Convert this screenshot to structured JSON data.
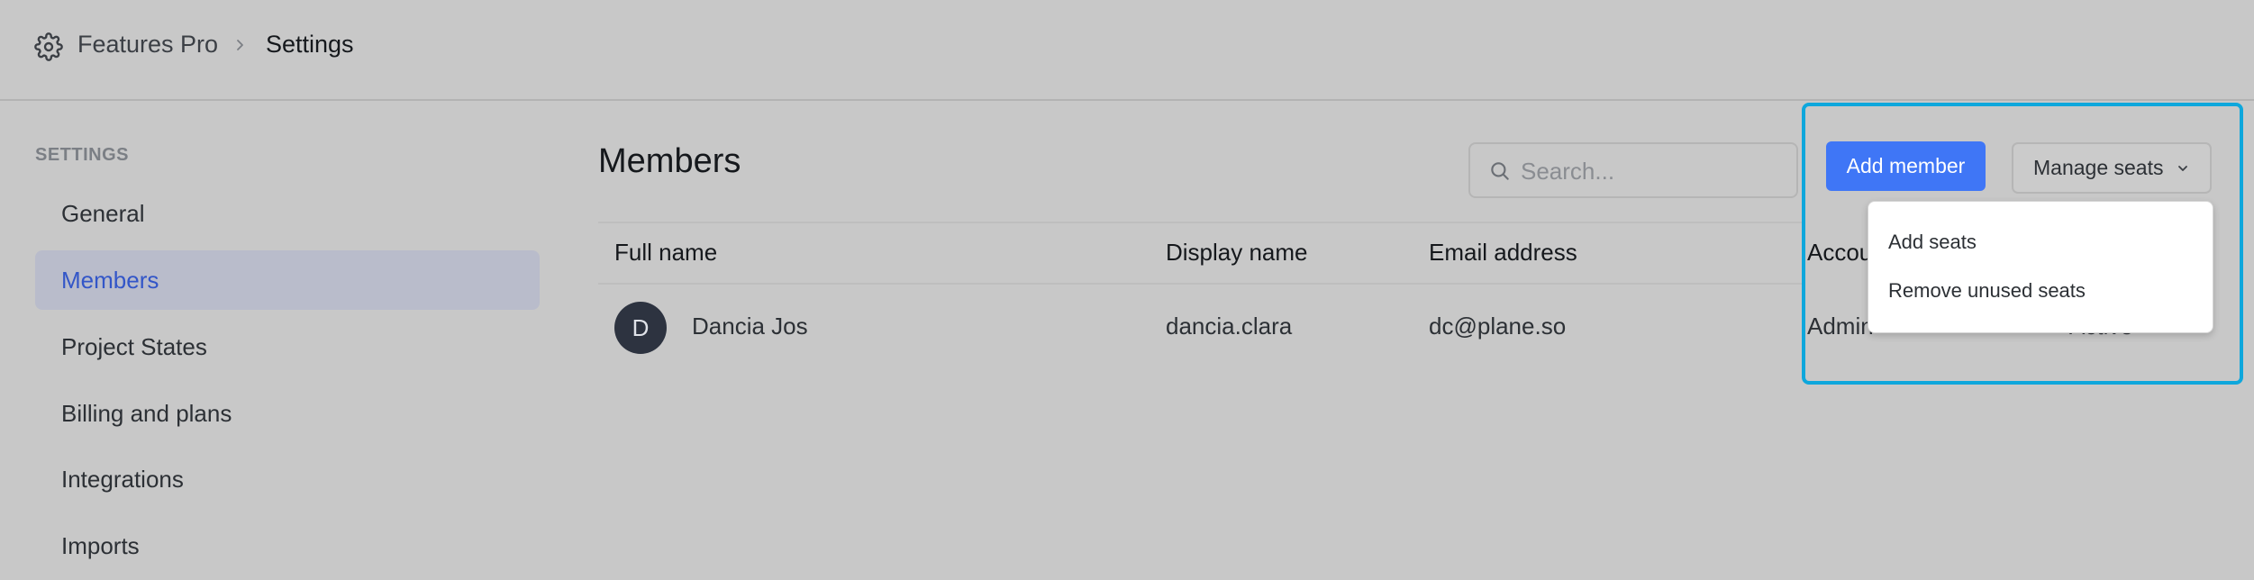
{
  "breadcrumb": {
    "root": "Features Pro",
    "current": "Settings"
  },
  "sidebar": {
    "heading": "SETTINGS",
    "items": [
      {
        "label": "General"
      },
      {
        "label": "Members",
        "active": true
      },
      {
        "label": "Project States"
      },
      {
        "label": "Billing and plans"
      },
      {
        "label": "Integrations"
      },
      {
        "label": "Imports"
      }
    ]
  },
  "main": {
    "title": "Members",
    "search": {
      "placeholder": "Search...",
      "value": ""
    },
    "table": {
      "columns": [
        "Full name",
        "Display name",
        "Email address",
        "Accou"
      ],
      "rows": [
        {
          "avatar_initial": "D",
          "full_name": "Dancia Jos",
          "display_name": "dancia.clara",
          "email": "dc@plane.so",
          "account_type": "Admin",
          "status": "Active"
        }
      ]
    }
  },
  "actions": {
    "add_member_label": "Add member",
    "manage_seats_label": "Manage seats",
    "manage_seats_menu": [
      "Add seats",
      "Remove unused seats"
    ]
  },
  "colors": {
    "accent": "#3f76f6",
    "active_nav_text": "#3356c8",
    "highlight_border": "#0ea7dc",
    "avatar_bg": "#2d3340"
  },
  "icons": {
    "breadcrumb": "gear-icon",
    "separator": "chevron-right-icon",
    "search": "search-icon",
    "dropdown": "chevron-down-icon"
  }
}
